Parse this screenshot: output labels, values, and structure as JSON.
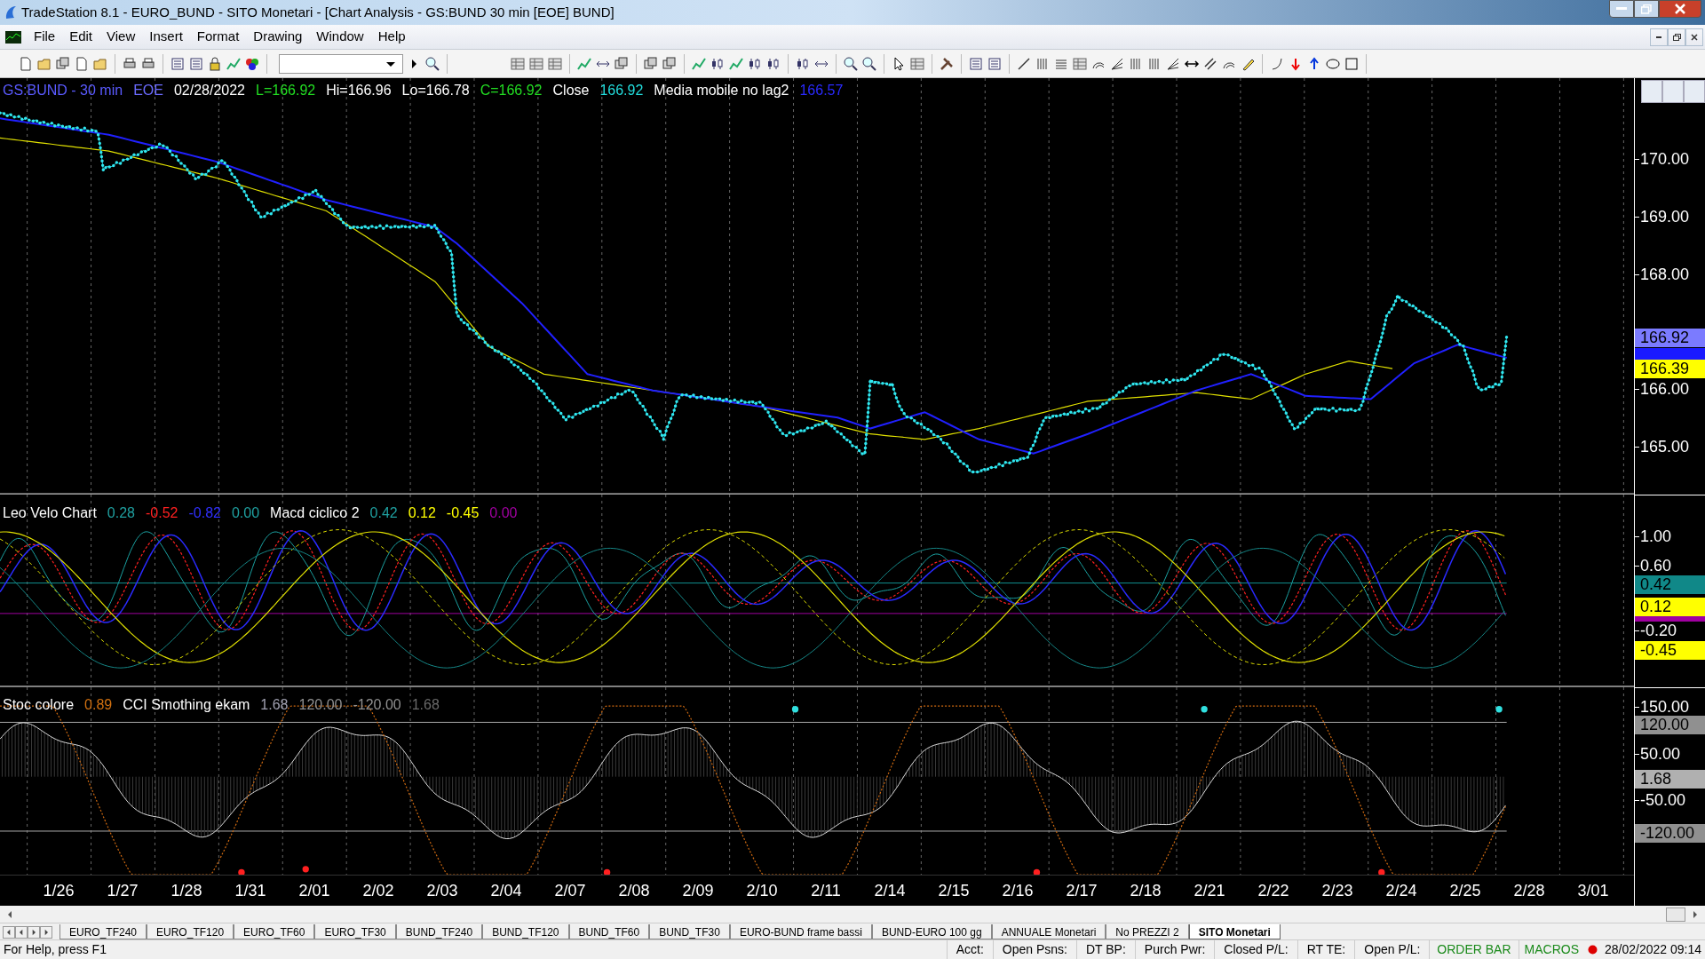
{
  "window": {
    "title": "TradeStation 8.1 - EURO_BUND - SITO Monetari - [Chart Analysis - GS:BUND  30 min  [EOE] BUND]"
  },
  "menu": [
    "File",
    "Edit",
    "View",
    "Insert",
    "Format",
    "Drawing",
    "Window",
    "Help"
  ],
  "chart": {
    "header": [
      {
        "text": "GS:BUND - 30 min",
        "color": "#5a5aff"
      },
      {
        "text": "EOE",
        "color": "#6b6bff"
      },
      {
        "text": "02/28/2022",
        "color": "#ffffff"
      },
      {
        "text": "L=166.92",
        "color": "#22dd22"
      },
      {
        "text": "Hi=166.96",
        "color": "#ffffff"
      },
      {
        "text": "Lo=166.78",
        "color": "#ffffff"
      },
      {
        "text": "C=166.92",
        "color": "#22dd22"
      },
      {
        "text": "Close",
        "color": "#ffffff"
      },
      {
        "text": "166.92",
        "color": "#22dddd"
      },
      {
        "text": "Media mobile no lag2",
        "color": "#ffffff"
      },
      {
        "text": "166.57",
        "color": "#2a2aff"
      }
    ],
    "price_axis": [
      "170.00",
      "169.00",
      "168.00",
      "166.00",
      "165.00"
    ],
    "price_badges": [
      {
        "text": "166.92",
        "color": "#7b7bff"
      },
      {
        "text": "166.39",
        "color": "#ffff00"
      }
    ],
    "indicator_1": {
      "legend": [
        {
          "text": "Leo Velo Chart",
          "color": "#ffffff"
        },
        {
          "text": "0.28",
          "color": "#1fa0a0"
        },
        {
          "text": "-0.52",
          "color": "#ff2020"
        },
        {
          "text": "-0.82",
          "color": "#3030ff"
        },
        {
          "text": "0.00",
          "color": "#1fa0a0"
        },
        {
          "text": "Macd ciclico 2",
          "color": "#ffffff"
        },
        {
          "text": "0.42",
          "color": "#1fa0a0"
        },
        {
          "text": "0.12",
          "color": "#ffff00"
        },
        {
          "text": "-0.45",
          "color": "#ffff00"
        },
        {
          "text": "0.00",
          "color": "#a000a0"
        }
      ],
      "axis": [
        "1.00",
        "0.60",
        "-0.20"
      ],
      "badges": [
        {
          "text": "0.42",
          "color": "#108888"
        },
        {
          "text": "0.12",
          "color": "#ffff00"
        },
        {
          "text": "-0.45",
          "color": "#ffff00"
        }
      ]
    },
    "indicator_2": {
      "legend": [
        {
          "text": "Stoc colore",
          "color": "#ffffff"
        },
        {
          "text": "0.89",
          "color": "#d07010"
        },
        {
          "text": "CCI Smothing ekam",
          "color": "#ffffff"
        },
        {
          "text": "1.68",
          "color": "#a0a0b0"
        },
        {
          "text": "120.00",
          "color": "#909090"
        },
        {
          "text": "-120.00",
          "color": "#909090"
        },
        {
          "text": "1.68",
          "color": "#6a6a6a"
        }
      ],
      "axis": [
        "150.00",
        "50.00",
        "-50.00"
      ],
      "badges": [
        {
          "text": "120.00",
          "color": "#909090"
        },
        {
          "text": "1.68",
          "color": "#b0b0b0"
        },
        {
          "text": "-120.00",
          "color": "#909090"
        }
      ]
    },
    "dates": [
      "1/26",
      "1/27",
      "1/28",
      "1/31",
      "2/01",
      "2/02",
      "2/03",
      "2/04",
      "2/07",
      "2/08",
      "2/09",
      "2/10",
      "2/11",
      "2/14",
      "2/15",
      "2/16",
      "2/17",
      "2/18",
      "2/21",
      "2/22",
      "2/23",
      "2/24",
      "2/25",
      "2/28",
      "3/01"
    ]
  },
  "tabs": [
    {
      "label": "EURO_TF240",
      "selected": false
    },
    {
      "label": "EURO_TF120",
      "selected": false
    },
    {
      "label": "EURO_TF60",
      "selected": false
    },
    {
      "label": "EURO_TF30",
      "selected": false
    },
    {
      "label": "BUND_TF240",
      "selected": false
    },
    {
      "label": "BUND_TF120",
      "selected": false
    },
    {
      "label": "BUND_TF60",
      "selected": false
    },
    {
      "label": "BUND_TF30",
      "selected": false
    },
    {
      "label": "EURO-BUND frame bassi",
      "selected": false
    },
    {
      "label": "BUND-EURO 100 gg",
      "selected": false
    },
    {
      "label": "ANNUALE Monetari",
      "selected": false
    },
    {
      "label": "No PREZZI 2",
      "selected": false
    },
    {
      "label": "SITO Monetari",
      "selected": true
    }
  ],
  "status_bar": {
    "help": "For Help, press F1",
    "fields": [
      "Acct:",
      "Open Psns:",
      "DT BP:",
      "Purch Pwr:",
      "Closed P/L:",
      "RT TE:",
      "Open P/L:"
    ],
    "order_bar": "ORDER BAR",
    "macros": "MACROS",
    "datetime": "28/02/2022 09:14"
  }
}
